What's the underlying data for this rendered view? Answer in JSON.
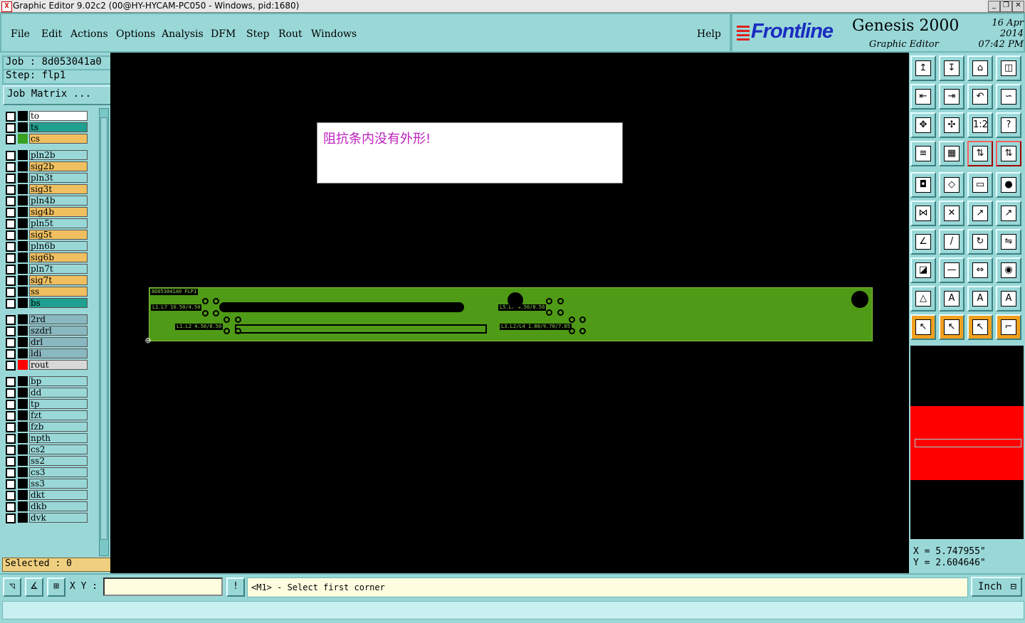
{
  "window": {
    "title": "Graphic Editor 9.02c2 (00@HY-HYCAM-PC050 - Windows, pid:1680)",
    "minimize": "_",
    "maximize": "❐",
    "close": "✕"
  },
  "menu": {
    "items": [
      "File",
      "Edit",
      "Actions",
      "Options",
      "Analysis",
      "DFM",
      "Step",
      "Rout",
      "Windows"
    ],
    "help": "Help"
  },
  "brand": {
    "logo": "Frontline",
    "product": "Genesis 2000",
    "subtitle": "Graphic Editor",
    "date": "16 Apr 2014",
    "time": "07:42 PM"
  },
  "job": {
    "job_line": "Job : 8d053041a0",
    "step_line": "Step: flp1",
    "matrix_button": "Job Matrix ..."
  },
  "layers": [
    {
      "name": "to",
      "color": "#ffffff",
      "swatch": "#000000"
    },
    {
      "name": "ts",
      "color": "#20a090",
      "swatch": "#000000"
    },
    {
      "name": "cs",
      "color": "#f0c060",
      "swatch": "#3aa020"
    },
    {
      "name": "pln2b",
      "color": "#9ad8d8",
      "swatch": "#000000"
    },
    {
      "name": "sig2b",
      "color": "#f0c060",
      "swatch": "#000000"
    },
    {
      "name": "pln3t",
      "color": "#9ad8d8",
      "swatch": "#000000"
    },
    {
      "name": "sig3t",
      "color": "#f0c060",
      "swatch": "#000000"
    },
    {
      "name": "pln4b",
      "color": "#9ad8d8",
      "swatch": "#000000"
    },
    {
      "name": "sig4b",
      "color": "#f0c060",
      "swatch": "#000000"
    },
    {
      "name": "pln5t",
      "color": "#9ad8d8",
      "swatch": "#000000"
    },
    {
      "name": "sig5t",
      "color": "#f0c060",
      "swatch": "#000000"
    },
    {
      "name": "pln6b",
      "color": "#9ad8d8",
      "swatch": "#000000"
    },
    {
      "name": "sig6b",
      "color": "#f0c060",
      "swatch": "#000000"
    },
    {
      "name": "pln7t",
      "color": "#9ad8d8",
      "swatch": "#000000"
    },
    {
      "name": "sig7t",
      "color": "#f0c060",
      "swatch": "#000000"
    },
    {
      "name": "ss",
      "color": "#f0c060",
      "swatch": "#000000"
    },
    {
      "name": "bs",
      "color": "#20a090",
      "swatch": "#000000"
    },
    {
      "name": "2rd",
      "color": "#8ab8c0",
      "swatch": "#000000"
    },
    {
      "name": "szdrl",
      "color": "#8ab8c0",
      "swatch": "#000000"
    },
    {
      "name": "drl",
      "color": "#8ab8c0",
      "swatch": "#000000"
    },
    {
      "name": "ldi",
      "color": "#8ab8c0",
      "swatch": "#000000"
    },
    {
      "name": "rout",
      "color": "#d8d8d8",
      "swatch": "#ff0000"
    },
    {
      "name": "bp",
      "color": "#9ad8d8",
      "swatch": "#000000"
    },
    {
      "name": "dd",
      "color": "#9ad8d8",
      "swatch": "#000000"
    },
    {
      "name": "tp",
      "color": "#9ad8d8",
      "swatch": "#000000"
    },
    {
      "name": "fzt",
      "color": "#9ad8d8",
      "swatch": "#000000"
    },
    {
      "name": "fzb",
      "color": "#9ad8d8",
      "swatch": "#000000"
    },
    {
      "name": "npth",
      "color": "#9ad8d8",
      "swatch": "#000000"
    },
    {
      "name": "cs2",
      "color": "#9ad8d8",
      "swatch": "#000000"
    },
    {
      "name": "ss2",
      "color": "#9ad8d8",
      "swatch": "#000000"
    },
    {
      "name": "cs3",
      "color": "#9ad8d8",
      "swatch": "#000000"
    },
    {
      "name": "ss3",
      "color": "#9ad8d8",
      "swatch": "#000000"
    },
    {
      "name": "dkt",
      "color": "#9ad8d8",
      "swatch": "#000000"
    },
    {
      "name": "dkb",
      "color": "#9ad8d8",
      "swatch": "#000000"
    },
    {
      "name": "dvk",
      "color": "#9ad8d8",
      "swatch": "#000000"
    }
  ],
  "selected": "Selected : 0",
  "canvas": {
    "message": "阻抗条内没有外形!",
    "board_label": "8D053041A0 FLP1",
    "silk_labels": [
      "L1.L7 10.50/4.50",
      "L1.L2 4.50/8.50",
      "L5.L7 4.50/8.50",
      "L3.L2/L4 1.80/9.70/7.85"
    ]
  },
  "tools": {
    "top": [
      "↥",
      "↧",
      "⌂",
      "◫",
      "⇤",
      "⇥",
      "↶",
      "∽",
      "✥",
      "✣",
      "1:2",
      "?",
      "≡",
      "▦",
      "⇅",
      "⇅"
    ],
    "middle": [
      "◘",
      "◇",
      "▭",
      "●",
      "⋈",
      "✕",
      "↗",
      "↗",
      "∠",
      "/",
      "↻",
      "⇋",
      "◪",
      "—",
      "⇔",
      "◉",
      "△",
      "A",
      "A",
      "A",
      "↖",
      "↖",
      "↖",
      "⌐"
    ]
  },
  "coords": {
    "x": "X = 5.747955\"",
    "y": "Y = 2.604646\""
  },
  "bottom": {
    "xy_label": "X Y :",
    "xy_value": "",
    "alert": "!",
    "prompt": "<M1> - Select first corner",
    "unit": "Inch"
  }
}
